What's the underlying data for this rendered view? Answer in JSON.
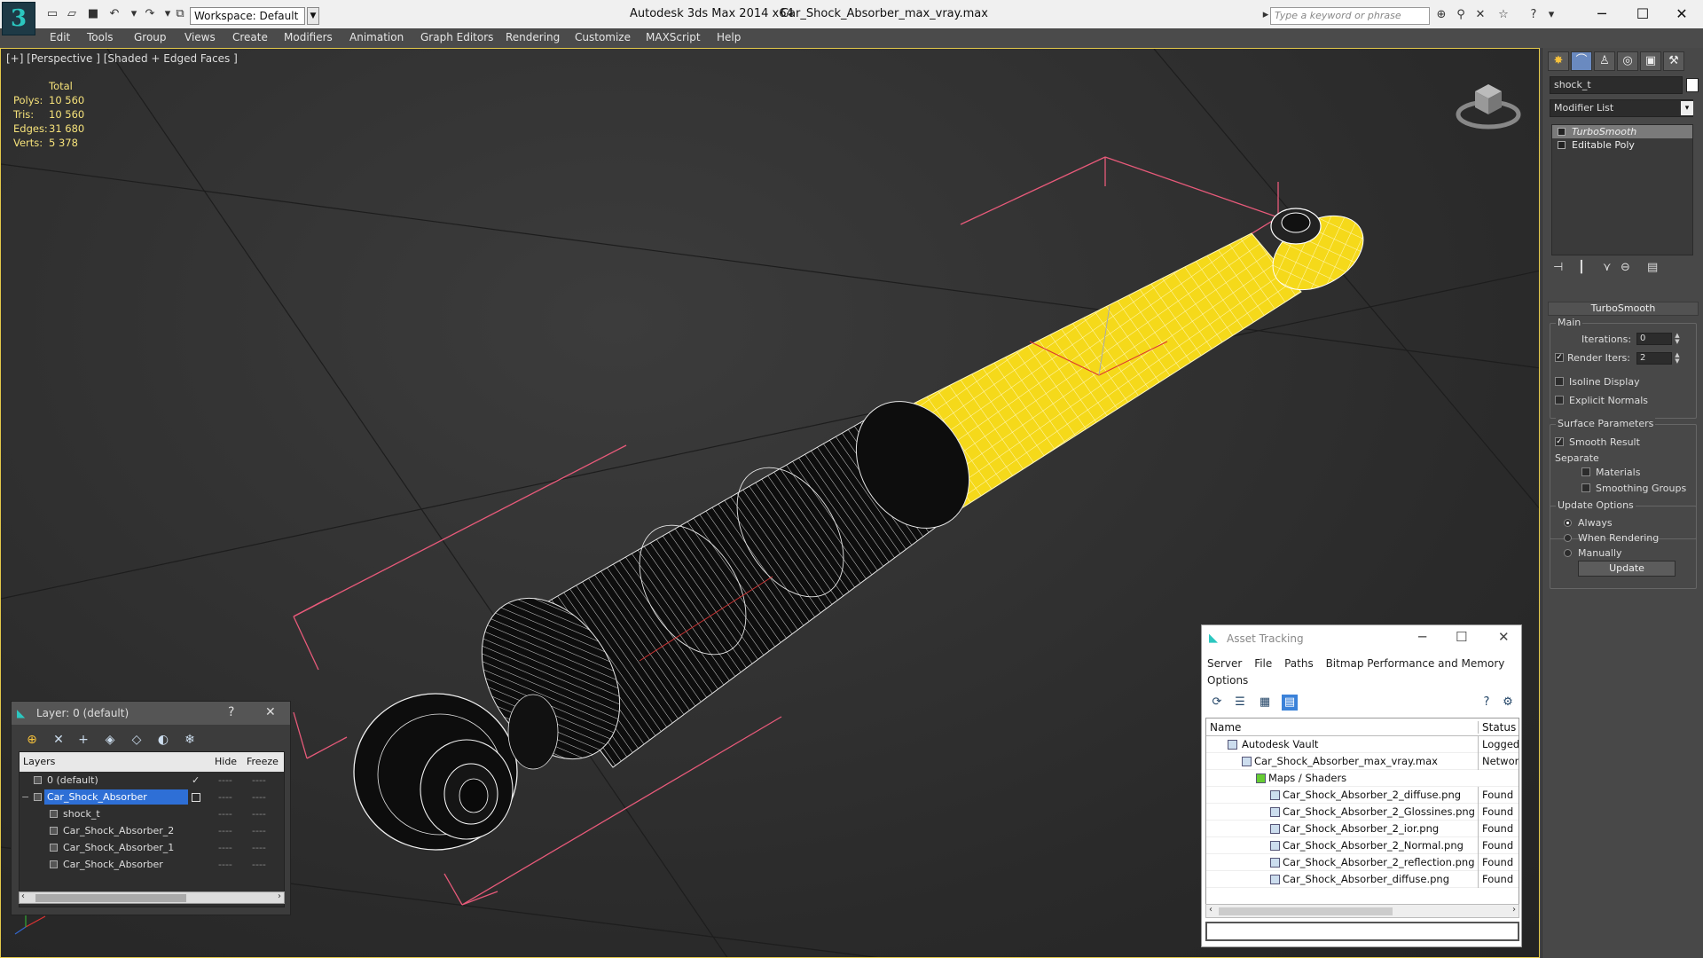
{
  "titlebar": {
    "workspace": "Workspace: Default",
    "app_title": "Autodesk 3ds Max  2014 x64",
    "file_title": "Car_Shock_Absorber_max_vray.max",
    "search_placeholder": "Type a keyword or phrase",
    "logo": "3"
  },
  "menu": [
    "Edit",
    "Tools",
    "Group",
    "Views",
    "Create",
    "Modifiers",
    "Animation",
    "Graph Editors",
    "Rendering",
    "Customize",
    "MAXScript",
    "Help"
  ],
  "viewport": {
    "label": "[+] [Perspective ] [Shaded + Edged Faces ]",
    "stats": {
      "header": "Total",
      "rows": [
        {
          "k": "Polys:",
          "v": "10 560"
        },
        {
          "k": "Tris:",
          "v": "10 560"
        },
        {
          "k": "Edges:",
          "v": "31 680"
        },
        {
          "k": "Verts:",
          "v": "5 378"
        }
      ]
    },
    "colors": {
      "yellow": "#f5d91a",
      "black_body": "#111111",
      "wire": "#ffffff",
      "bbox": "#e85a7a",
      "border": "#e4c94a"
    }
  },
  "command_panel": {
    "object_name": "shock_t",
    "modifier_list": "Modifier List",
    "stack": [
      "TurboSmooth",
      "Editable Poly"
    ],
    "rollout": "TurboSmooth",
    "main_group": "Main",
    "iterations_label": "Iterations:",
    "iterations_value": "0",
    "render_iters_label": "Render Iters:",
    "render_iters_value": "2",
    "isoline": "Isoline Display",
    "explicit_normals": "Explicit Normals",
    "surface_group": "Surface Parameters",
    "smooth_result": "Smooth Result",
    "separate": "Separate",
    "materials": "Materials",
    "smoothing_groups": "Smoothing Groups",
    "update_group": "Update Options",
    "always": "Always",
    "when_rendering": "When Rendering",
    "manually": "Manually",
    "update_button": "Update"
  },
  "layer_dialog": {
    "title": "Layer: 0 (default)",
    "help": "?",
    "columns": [
      "Layers",
      "Hide",
      "Freeze"
    ],
    "rows": [
      {
        "name": "0 (default)",
        "indent": 0
      },
      {
        "name": "Car_Shock_Absorber",
        "indent": 0
      },
      {
        "name": "shock_t",
        "indent": 1
      },
      {
        "name": "Car_Shock_Absorber_2",
        "indent": 1
      },
      {
        "name": "Car_Shock_Absorber_1",
        "indent": 1
      },
      {
        "name": "Car_Shock_Absorber",
        "indent": 1
      }
    ],
    "dots": "----"
  },
  "asset_tracking": {
    "title": "Asset Tracking",
    "menu": [
      "Server",
      "File",
      "Paths",
      "Bitmap Performance and Memory",
      "Options"
    ],
    "columns": [
      "Name",
      "Status"
    ],
    "rows": [
      {
        "name": "Autodesk Vault",
        "status": "Logged",
        "indent": 1
      },
      {
        "name": "Car_Shock_Absorber_max_vray.max",
        "status": "Network",
        "indent": 2
      },
      {
        "name": "Maps / Shaders",
        "status": "",
        "indent": 3
      },
      {
        "name": "Car_Shock_Absorber_2_diffuse.png",
        "status": "Found",
        "indent": 4
      },
      {
        "name": "Car_Shock_Absorber_2_Glossines.png",
        "status": "Found",
        "indent": 4
      },
      {
        "name": "Car_Shock_Absorber_2_ior.png",
        "status": "Found",
        "indent": 4
      },
      {
        "name": "Car_Shock_Absorber_2_Normal.png",
        "status": "Found",
        "indent": 4
      },
      {
        "name": "Car_Shock_Absorber_2_reflection.png",
        "status": "Found",
        "indent": 4
      },
      {
        "name": "Car_Shock_Absorber_diffuse.png",
        "status": "Found",
        "indent": 4
      }
    ]
  }
}
